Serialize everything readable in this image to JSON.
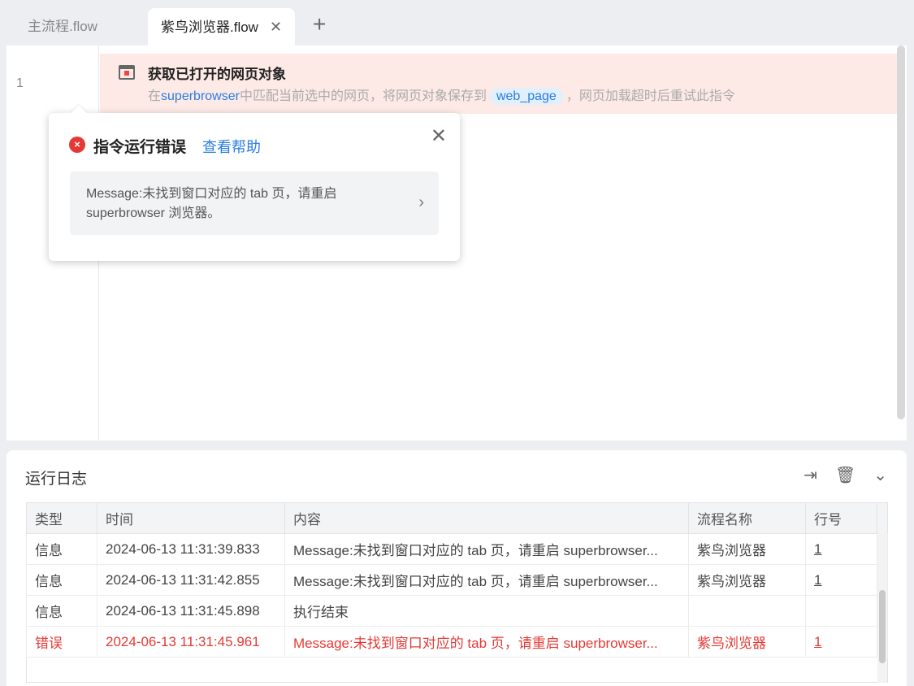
{
  "tabs": [
    {
      "label": "主流程.flow"
    },
    {
      "label": "紫鸟浏览器.flow",
      "close": "✕"
    }
  ],
  "add_tab": "+",
  "editor": {
    "line": "1",
    "command": {
      "title": "获取已打开的网页对象",
      "desc_prefix": "在",
      "desc_link": "superbrowser",
      "desc_mid": "中匹配当前选中的网页，将网页对象保存到",
      "variable": "web_page",
      "desc_suffix": "，网页加载超时后重试此指令"
    }
  },
  "popup": {
    "title": "指令运行错误",
    "help": "查看帮助",
    "close": "✕",
    "message": "Message:未找到窗口对应的 tab 页，请重启 superbrowser 浏览器。",
    "chevron": "›"
  },
  "log": {
    "title": "运行日志",
    "columns": [
      "类型",
      "时间",
      "内容",
      "流程名称",
      "行号"
    ],
    "rows": [
      {
        "type": "信息",
        "time": "2024-06-13 11:31:39.833",
        "content": "Message:未找到窗口对应的 tab 页，请重启 superbrowser...",
        "flow": "紫鸟浏览器",
        "line": "1",
        "error": false
      },
      {
        "type": "信息",
        "time": "2024-06-13 11:31:42.855",
        "content": "Message:未找到窗口对应的 tab 页，请重启 superbrowser...",
        "flow": "紫鸟浏览器",
        "line": "1",
        "error": false
      },
      {
        "type": "信息",
        "time": "2024-06-13 11:31:45.898",
        "content": "执行结束",
        "flow": "",
        "line": "",
        "error": false
      },
      {
        "type": "错误",
        "time": "2024-06-13 11:31:45.961",
        "content": "Message:未找到窗口对应的 tab 页，请重启 superbrowser...",
        "flow": "紫鸟浏览器",
        "line": "1",
        "error": true
      }
    ]
  },
  "colors": {
    "accent": "#2a7de1",
    "error": "#e53935",
    "highlight": "#fdeae6"
  }
}
